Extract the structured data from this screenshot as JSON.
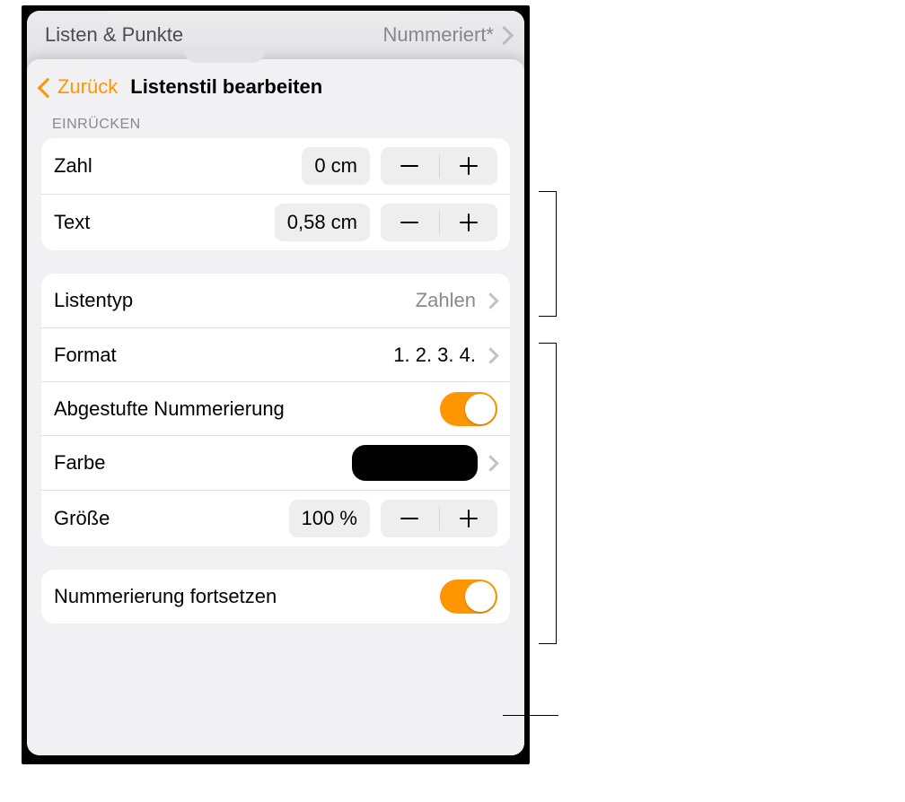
{
  "tab": {
    "label": "Listen & Punkte",
    "value": "Nummeriert*"
  },
  "nav": {
    "back": "Zurück",
    "title": "Listenstil bearbeiten"
  },
  "sections": {
    "indent_header": "EINRÜCKEN"
  },
  "indent": {
    "number_label": "Zahl",
    "number_value": "0 cm",
    "text_label": "Text",
    "text_value": "0,58 cm"
  },
  "list": {
    "type_label": "Listentyp",
    "type_value": "Zahlen",
    "format_label": "Format",
    "format_value": "1. 2. 3. 4.",
    "tiered_label": "Abgestufte Nummerierung",
    "color_label": "Farbe",
    "size_label": "Größe",
    "size_value": "100 %"
  },
  "continue": {
    "label": "Nummerierung fortsetzen"
  },
  "colors": {
    "accent": "#ff9500",
    "swatch": "#000000"
  }
}
